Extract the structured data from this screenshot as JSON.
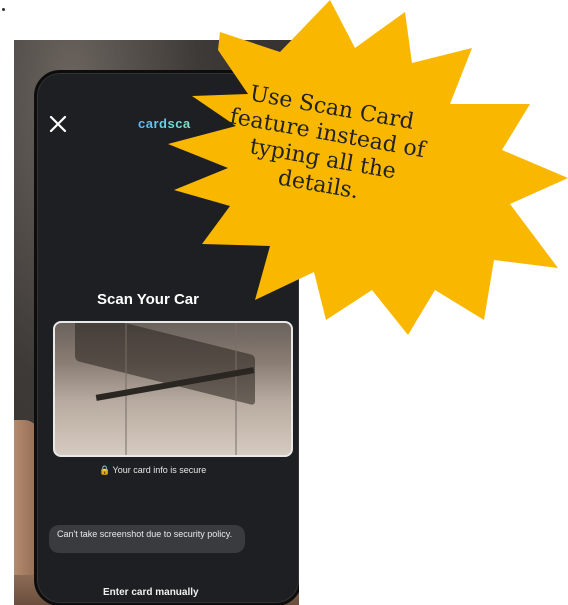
{
  "phone": {
    "logo": "cardsca",
    "scan_title": "Scan Your Car",
    "secure_text": "🔒 Your card info is secure",
    "toast_text": "Can't take screenshot due to security policy.",
    "manual_entry": "Enter card manually"
  },
  "callout": {
    "text": "Use Scan Card feature instead of typing all the details."
  },
  "colors": {
    "burst_fill": "#F9B700",
    "screen_bg": "#1E1F22"
  }
}
